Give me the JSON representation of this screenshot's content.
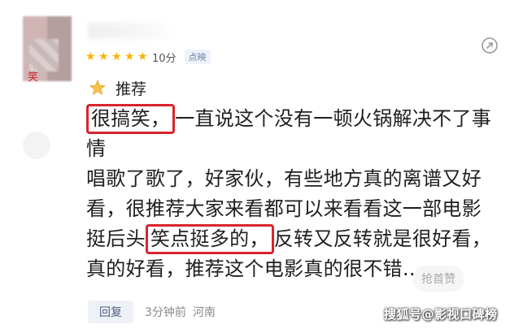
{
  "comment": {
    "avatar_tag": "笑",
    "rating": {
      "stars": 5,
      "score_text": "10分",
      "source_badge": "点映"
    },
    "recommend_label": "推荐",
    "review": {
      "line1_highlight": "很搞笑，",
      "line1_rest": "一直说这个没有一顿火锅解决不了事",
      "line2": "情",
      "line3": "唱歌了歌了，好家伙，有些地方真的离谱又好",
      "line4": "看，很推荐大家来看都可以来看看这一部电影",
      "line5_pre": "挺后头",
      "line5_highlight": "笑点挺多的，",
      "line5_rest": "反转又反转就是很好看，",
      "line6": "真的好看，推荐这个电影真的很不错…"
    },
    "like_label": "抢首赞",
    "reply_label": "回复",
    "time_text": "3分钟前",
    "location_text": "河南"
  },
  "watermark": "搜狐号@影视口碑榜",
  "colors": {
    "highlight_border": "#d9242d",
    "star": "#f5b400",
    "reply_text": "#50607d"
  },
  "icons": {
    "share": "share-icon",
    "recommend": "thumb-icon",
    "star": "star-icon"
  }
}
